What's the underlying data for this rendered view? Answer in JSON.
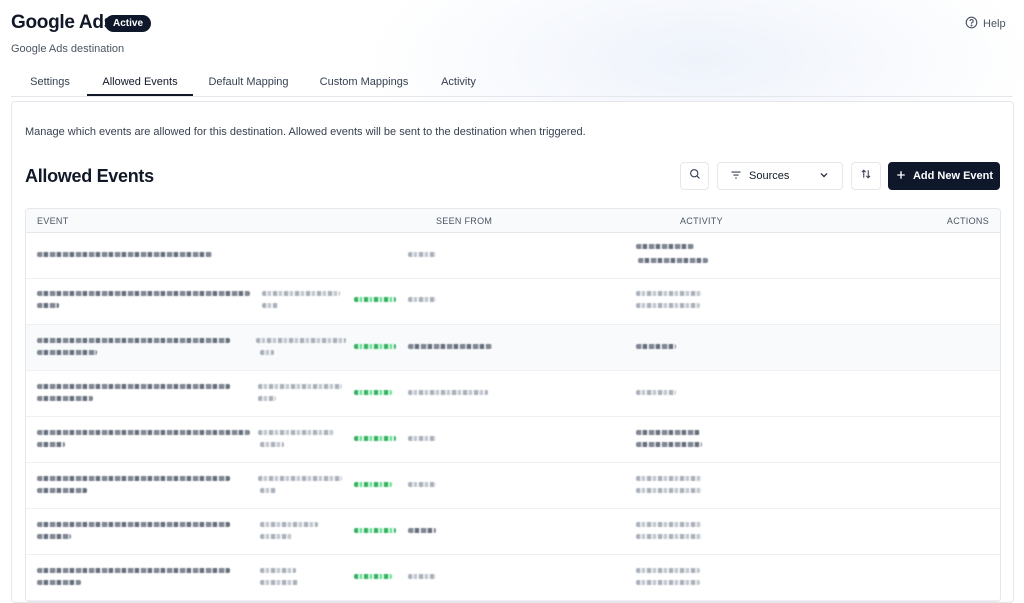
{
  "header": {
    "title": "Google Ads",
    "status_badge": "Active",
    "subtitle": "Google Ads destination",
    "help_label": "Help"
  },
  "tabs": [
    {
      "label": "Settings",
      "active": false
    },
    {
      "label": "Allowed Events",
      "active": true
    },
    {
      "label": "Default Mapping",
      "active": false
    },
    {
      "label": "Custom Mappings",
      "active": false
    },
    {
      "label": "Activity",
      "active": false
    }
  ],
  "main": {
    "description": "Manage which events are allowed for this destination. Allowed events will be sent to the destination when triggered.",
    "section_title": "Allowed Events",
    "toolbar": {
      "search_icon": "search-icon",
      "sources_label": "Sources",
      "sort_icon": "sort-icon",
      "add_label": "Add New Event"
    },
    "table": {
      "columns": [
        "EVENT",
        "SEEN FROM",
        "ACTIVITY",
        "ACTIONS"
      ]
    }
  },
  "colors": {
    "primary": "#0f172a",
    "status_green": "#16a34a",
    "border": "#e5e7eb"
  }
}
